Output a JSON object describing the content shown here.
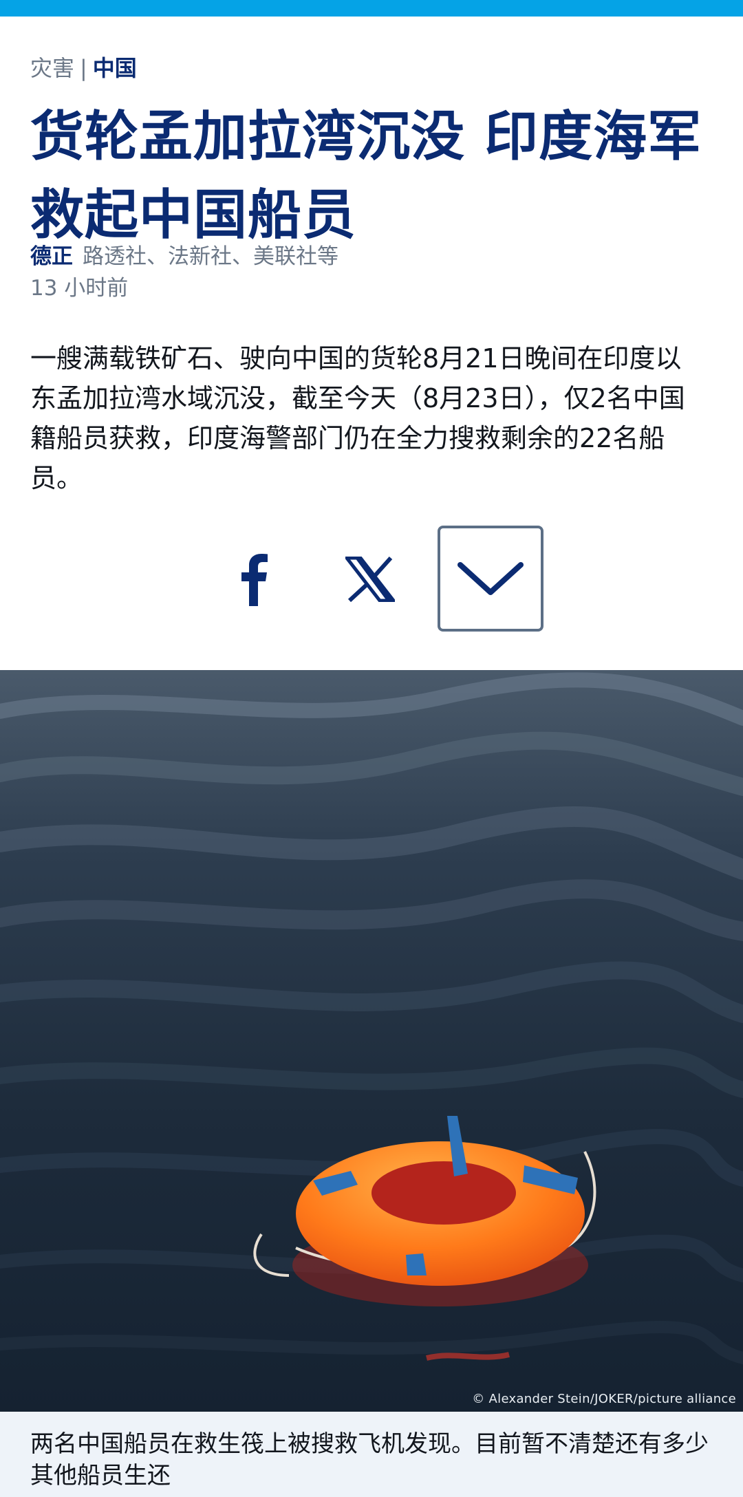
{
  "breadcrumb": {
    "section": "灾害",
    "separator": "|",
    "category": "中国"
  },
  "article": {
    "headline": "货轮孟加拉湾沉没 印度海军救起中国船员",
    "author": "德正",
    "sources": "路透社、法新社、美联社等",
    "published": "13 小时前",
    "lead": "一艘满载铁矿石、驶向中国的货轮8月21日晚间在印度以东孟加拉湾水域沉没，截至今天（8月23日），仅2名中国籍船员获救，印度海警部门仍在全力搜救剩余的22名船员。"
  },
  "share": {
    "facebook_glyph": "f",
    "x_glyph": "𝕏"
  },
  "image": {
    "credit": "© Alexander Stein/JOKER/picture alliance",
    "caption": "两名中国船员在救生筏上被搜救飞机发现。目前暂不清楚还有多少其他船员生还"
  },
  "icons": {
    "share_facebook": "facebook-icon",
    "share_x": "x-icon",
    "share_more": "chevron-down-icon"
  },
  "colors": {
    "top_bar": "#05a3e6",
    "headline": "#0b2b72",
    "meta": "#6b7787",
    "caption_bg": "#eef3f9"
  }
}
